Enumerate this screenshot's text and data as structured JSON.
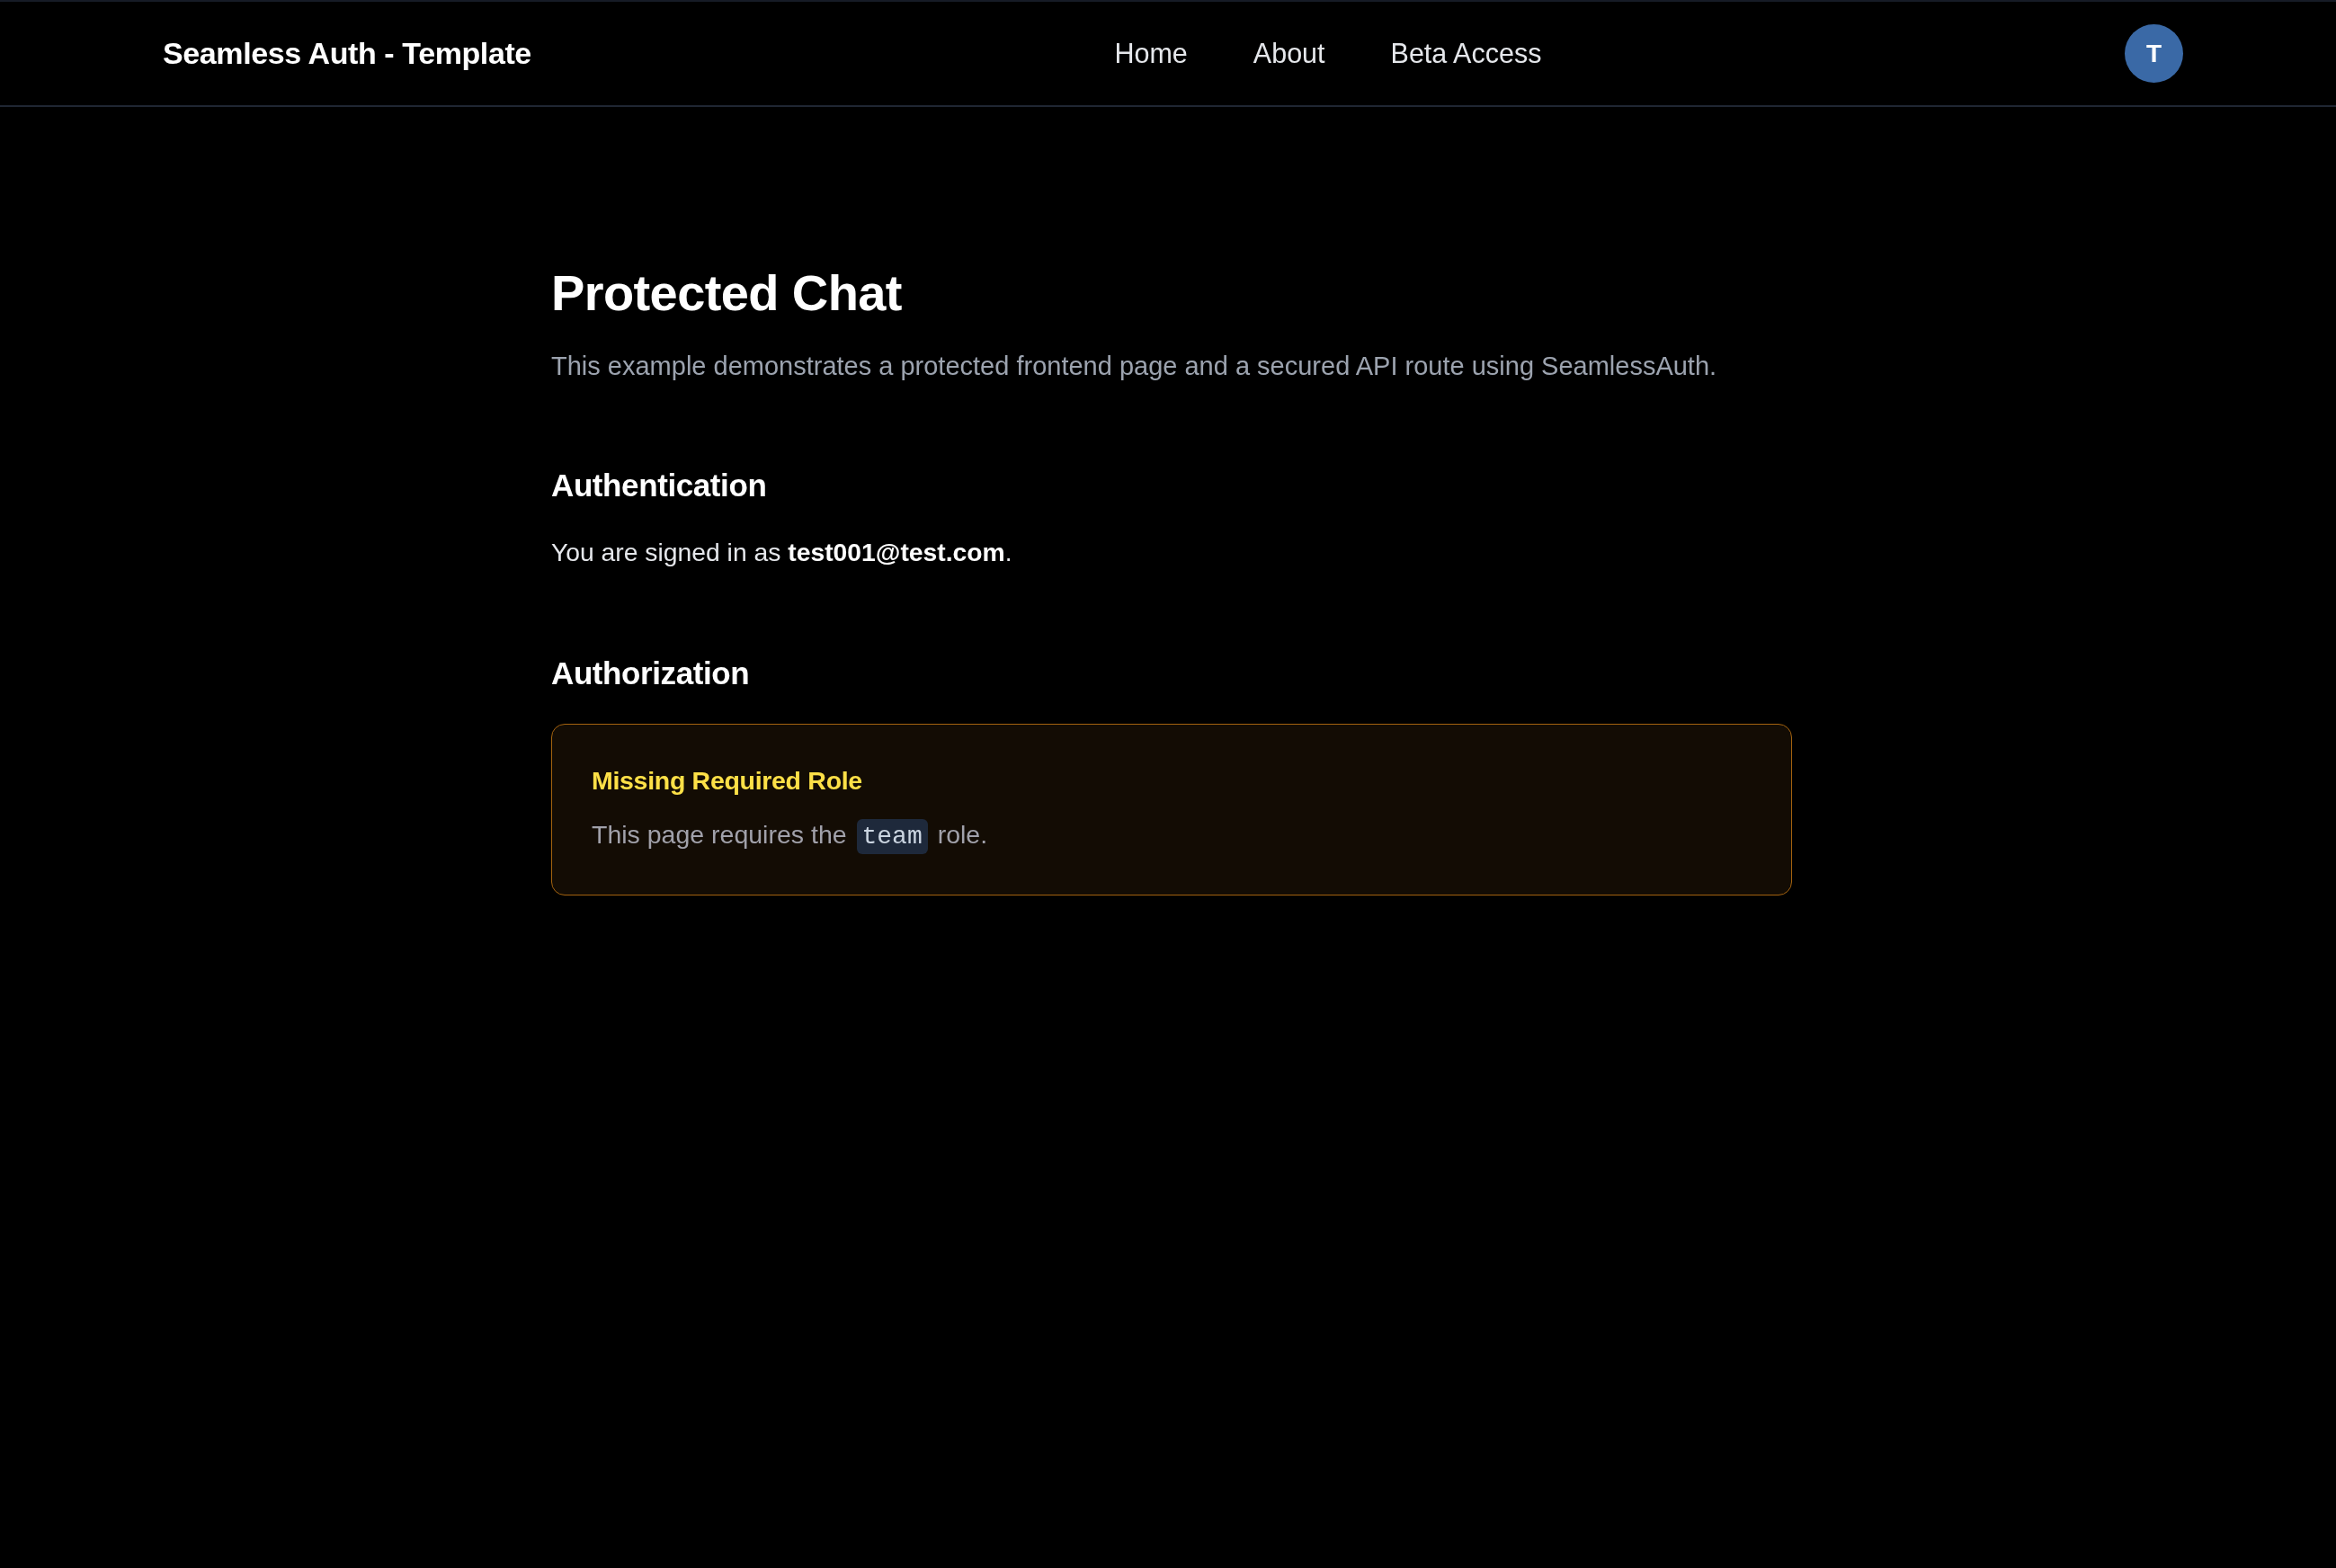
{
  "header": {
    "title": "Seamless Auth - Template",
    "nav": [
      {
        "label": "Home"
      },
      {
        "label": "About"
      },
      {
        "label": "Beta Access"
      }
    ],
    "avatar": {
      "initial": "T"
    }
  },
  "page": {
    "title": "Protected Chat",
    "description": "This example demonstrates a protected frontend page and a secured API route using SeamlessAuth.",
    "sections": [
      {
        "kind": "text",
        "heading": "Authentication",
        "text": "You are signed in as **test001@test.com**."
      },
      {
        "kind": "alert",
        "heading": "Authorization",
        "alert": {
          "kind": "warning",
          "title": "Missing Required Role",
          "text_before": "This page requires the",
          "code": "team",
          "text_after": "role."
        }
      }
    ]
  }
}
